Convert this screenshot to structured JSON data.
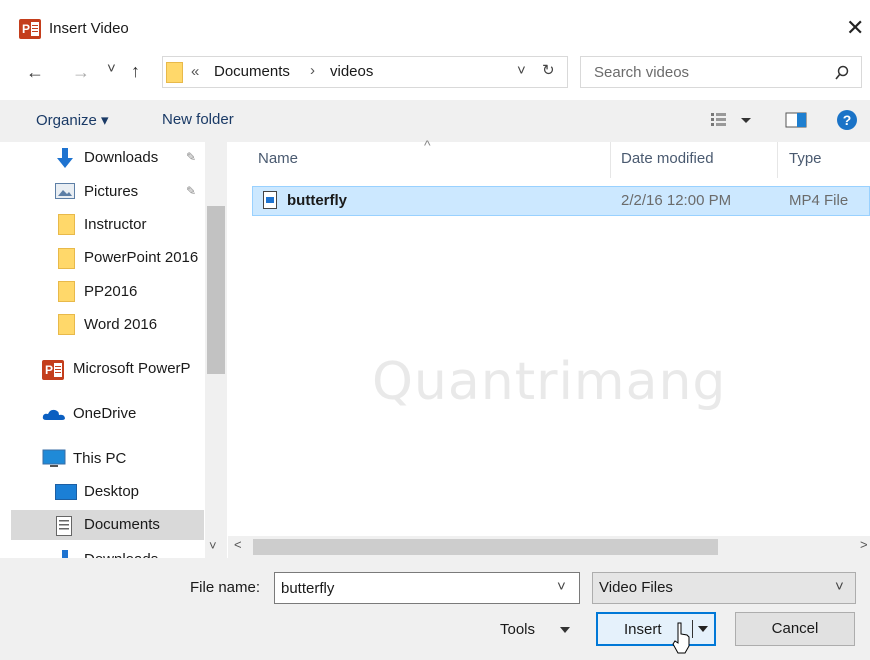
{
  "window": {
    "title": "Insert Video",
    "app_icon_letter": "P",
    "close": "✕"
  },
  "nav": {
    "back": "←",
    "forward": "→",
    "recent": "˅",
    "up": "↑"
  },
  "address": {
    "overflow": "«",
    "breadcrumbs": [
      "Documents",
      "videos"
    ],
    "separator": "›",
    "dropdown": "˅",
    "refresh": "↻"
  },
  "search": {
    "placeholder": "Search videos",
    "icon": "magnifier-icon"
  },
  "toolbar": {
    "organize": "Organize ▾",
    "new_folder": "New folder"
  },
  "sidebar": {
    "items": [
      {
        "label": "Downloads",
        "icon": "download-arrow-icon",
        "pinned": true
      },
      {
        "label": "Pictures",
        "icon": "pictures-icon",
        "pinned": true
      },
      {
        "label": "Instructor",
        "icon": "folder-icon"
      },
      {
        "label": "PowerPoint 2016",
        "icon": "folder-icon"
      },
      {
        "label": "PP2016",
        "icon": "folder-icon"
      },
      {
        "label": "Word 2016",
        "icon": "folder-icon"
      },
      {
        "label": "Microsoft PowerP",
        "icon": "powerpoint-icon"
      },
      {
        "label": "OneDrive",
        "icon": "cloud-icon"
      },
      {
        "label": "This PC",
        "icon": "computer-icon"
      },
      {
        "label": "Desktop",
        "icon": "desktop-icon"
      },
      {
        "label": "Documents",
        "icon": "documents-icon",
        "selected": true
      },
      {
        "label": "Downloads",
        "icon": "download-arrow-icon"
      }
    ]
  },
  "filelist": {
    "columns": [
      "Name",
      "Date modified",
      "Type"
    ],
    "rows": [
      {
        "name": "butterfly",
        "date": "2/2/16 12:00 PM",
        "type": "MP4 File",
        "selected": true
      }
    ]
  },
  "watermark": "Quantrimang",
  "bottom": {
    "filename_label": "File name:",
    "filename_value": "butterfly",
    "filetype_value": "Video Files",
    "tools_label": "Tools",
    "insert_label": "Insert",
    "cancel_label": "Cancel"
  },
  "colors": {
    "selection": "#cce8ff",
    "accent": "#0078d7",
    "help": "#1a73c7",
    "folder": "#ffd86a",
    "powerpoint": "#c43e1c"
  }
}
